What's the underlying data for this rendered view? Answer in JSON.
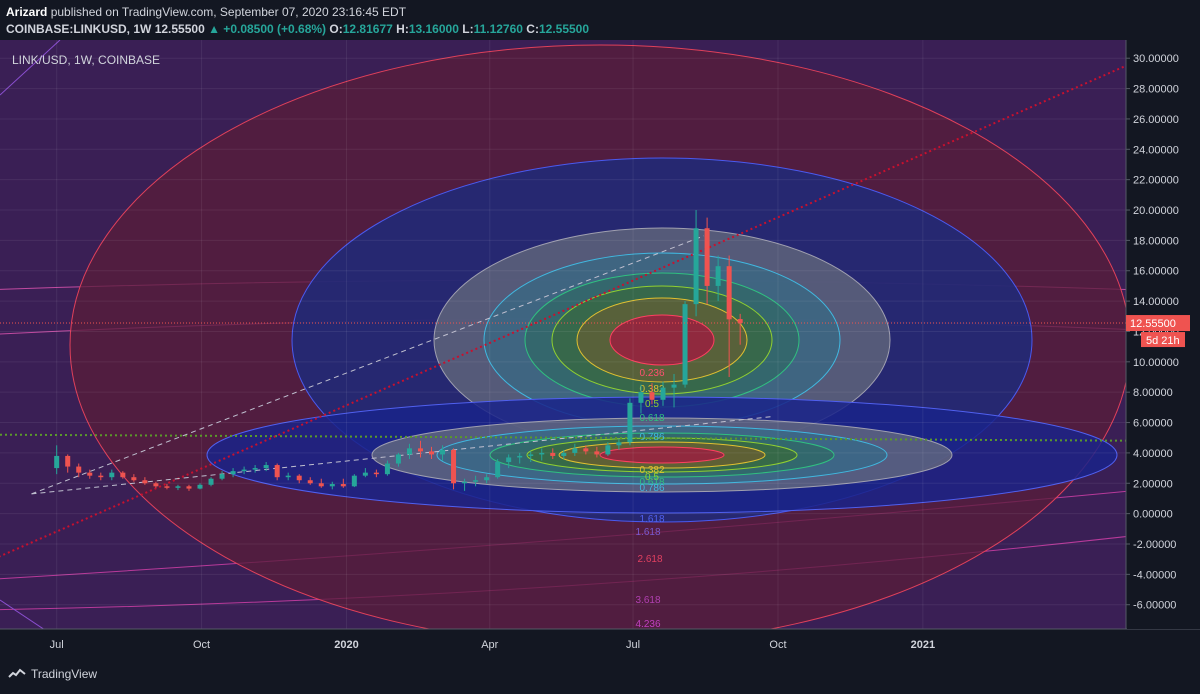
{
  "header": {
    "author": "Arizard",
    "published": "published on TradingView.com, September 07, 2020 23:16:45 EDT",
    "symbol": "COINBASE:LINKUSD, 1W",
    "last": "12.55500",
    "change": "▲ +0.08500 (+0.68%)",
    "open_label": "O:",
    "open": "12.81677",
    "high_label": "H:",
    "high": "13.16000",
    "low_label": "L:",
    "low": "11.12760",
    "close_label": "C:",
    "close": "12.55500"
  },
  "footer": {
    "brand": "TradingView"
  },
  "colors": {
    "background": "#131722",
    "up": "#26a69a",
    "down": "#ef5350",
    "price_badge": "#ef5350",
    "fib_green": "#5a9a2a",
    "trend_red": "#c8102e"
  },
  "chart_data": {
    "type": "candlestick",
    "title": "LINK/USD, 1W, COINBASE",
    "ylim": [
      -7.6,
      31.2
    ],
    "xlim": [
      "2019-05-26",
      "2021-05-10"
    ],
    "y_ticks": [
      "30.00000",
      "28.00000",
      "26.00000",
      "24.00000",
      "22.00000",
      "20.00000",
      "18.00000",
      "16.00000",
      "14.00000",
      "12.00000",
      "10.00000",
      "8.00000",
      "6.00000",
      "4.00000",
      "2.00000",
      "0.00000",
      "-2.00000",
      "-4.00000",
      "-6.00000"
    ],
    "x_ticks": [
      {
        "label": "Jul",
        "date": "2019-07-01"
      },
      {
        "label": "Oct",
        "date": "2019-10-01"
      },
      {
        "label": "2020",
        "date": "2020-01-01"
      },
      {
        "label": "Apr",
        "date": "2020-04-01"
      },
      {
        "label": "Jul",
        "date": "2020-07-01"
      },
      {
        "label": "Oct",
        "date": "2020-10-01"
      },
      {
        "label": "2021",
        "date": "2021-01-01"
      }
    ],
    "last_price": {
      "value": 12.555,
      "label": "12.55500",
      "countdown": "5d 21h"
    },
    "horizontal_dotted_level": 5.2,
    "fib_upper_labels": [
      "0.236",
      "0.382",
      "0.5",
      "0.618",
      "0.786"
    ],
    "fib_lower_labels": [
      "0.382",
      "0.5",
      "0.618",
      "0.786",
      "1.618",
      "1.618",
      "2.618",
      "3.618",
      "4.236"
    ],
    "candles": [
      {
        "d": "2019-07-01",
        "o": 3.0,
        "h": 4.5,
        "l": 2.6,
        "c": 3.8
      },
      {
        "d": "2019-07-08",
        "o": 3.8,
        "h": 3.9,
        "l": 2.7,
        "c": 3.1
      },
      {
        "d": "2019-07-15",
        "o": 3.1,
        "h": 3.3,
        "l": 2.4,
        "c": 2.7
      },
      {
        "d": "2019-07-22",
        "o": 2.7,
        "h": 2.9,
        "l": 2.3,
        "c": 2.5
      },
      {
        "d": "2019-07-29",
        "o": 2.5,
        "h": 2.7,
        "l": 2.2,
        "c": 2.4
      },
      {
        "d": "2019-08-05",
        "o": 2.4,
        "h": 2.9,
        "l": 2.2,
        "c": 2.7
      },
      {
        "d": "2019-08-12",
        "o": 2.7,
        "h": 2.8,
        "l": 2.3,
        "c": 2.4
      },
      {
        "d": "2019-08-19",
        "o": 2.4,
        "h": 2.6,
        "l": 2.1,
        "c": 2.2
      },
      {
        "d": "2019-08-26",
        "o": 2.2,
        "h": 2.4,
        "l": 1.9,
        "c": 2.0
      },
      {
        "d": "2019-09-02",
        "o": 2.0,
        "h": 2.1,
        "l": 1.7,
        "c": 1.8
      },
      {
        "d": "2019-09-09",
        "o": 1.8,
        "h": 1.95,
        "l": 1.6,
        "c": 1.7
      },
      {
        "d": "2019-09-16",
        "o": 1.7,
        "h": 1.9,
        "l": 1.55,
        "c": 1.8
      },
      {
        "d": "2019-09-23",
        "o": 1.8,
        "h": 1.9,
        "l": 1.5,
        "c": 1.65
      },
      {
        "d": "2019-09-30",
        "o": 1.65,
        "h": 2.0,
        "l": 1.6,
        "c": 1.9
      },
      {
        "d": "2019-10-07",
        "o": 1.9,
        "h": 2.4,
        "l": 1.8,
        "c": 2.3
      },
      {
        "d": "2019-10-14",
        "o": 2.3,
        "h": 2.8,
        "l": 2.2,
        "c": 2.6
      },
      {
        "d": "2019-10-21",
        "o": 2.6,
        "h": 3.0,
        "l": 2.4,
        "c": 2.8
      },
      {
        "d": "2019-10-28",
        "o": 2.8,
        "h": 3.1,
        "l": 2.6,
        "c": 2.9
      },
      {
        "d": "2019-11-04",
        "o": 2.9,
        "h": 3.2,
        "l": 2.7,
        "c": 3.0
      },
      {
        "d": "2019-11-11",
        "o": 3.0,
        "h": 3.4,
        "l": 2.8,
        "c": 3.2
      },
      {
        "d": "2019-11-18",
        "o": 3.2,
        "h": 3.3,
        "l": 2.2,
        "c": 2.4
      },
      {
        "d": "2019-11-25",
        "o": 2.4,
        "h": 2.7,
        "l": 2.2,
        "c": 2.5
      },
      {
        "d": "2019-12-02",
        "o": 2.5,
        "h": 2.6,
        "l": 2.0,
        "c": 2.2
      },
      {
        "d": "2019-12-09",
        "o": 2.2,
        "h": 2.4,
        "l": 1.9,
        "c": 2.0
      },
      {
        "d": "2019-12-16",
        "o": 2.0,
        "h": 2.3,
        "l": 1.7,
        "c": 1.8
      },
      {
        "d": "2019-12-23",
        "o": 1.8,
        "h": 2.1,
        "l": 1.6,
        "c": 1.95
      },
      {
        "d": "2019-12-30",
        "o": 1.95,
        "h": 2.3,
        "l": 1.7,
        "c": 1.8
      },
      {
        "d": "2020-01-06",
        "o": 1.8,
        "h": 2.6,
        "l": 1.75,
        "c": 2.5
      },
      {
        "d": "2020-01-13",
        "o": 2.5,
        "h": 3.0,
        "l": 2.4,
        "c": 2.7
      },
      {
        "d": "2020-01-20",
        "o": 2.7,
        "h": 2.9,
        "l": 2.4,
        "c": 2.6
      },
      {
        "d": "2020-01-27",
        "o": 2.6,
        "h": 3.5,
        "l": 2.5,
        "c": 3.3
      },
      {
        "d": "2020-02-03",
        "o": 3.3,
        "h": 4.0,
        "l": 3.1,
        "c": 3.9
      },
      {
        "d": "2020-02-10",
        "o": 3.9,
        "h": 4.6,
        "l": 3.6,
        "c": 4.3
      },
      {
        "d": "2020-02-17",
        "o": 4.3,
        "h": 4.8,
        "l": 3.7,
        "c": 4.1
      },
      {
        "d": "2020-02-24",
        "o": 4.1,
        "h": 4.4,
        "l": 3.6,
        "c": 3.9
      },
      {
        "d": "2020-03-02",
        "o": 3.9,
        "h": 4.5,
        "l": 3.5,
        "c": 4.2
      },
      {
        "d": "2020-03-09",
        "o": 4.2,
        "h": 4.3,
        "l": 1.6,
        "c": 2.0
      },
      {
        "d": "2020-03-16",
        "o": 2.0,
        "h": 2.3,
        "l": 1.5,
        "c": 2.1
      },
      {
        "d": "2020-03-23",
        "o": 2.1,
        "h": 2.5,
        "l": 1.8,
        "c": 2.2
      },
      {
        "d": "2020-03-30",
        "o": 2.2,
        "h": 2.6,
        "l": 2.0,
        "c": 2.4
      },
      {
        "d": "2020-04-06",
        "o": 2.4,
        "h": 3.6,
        "l": 2.3,
        "c": 3.4
      },
      {
        "d": "2020-04-13",
        "o": 3.4,
        "h": 3.9,
        "l": 3.0,
        "c": 3.7
      },
      {
        "d": "2020-04-20",
        "o": 3.7,
        "h": 4.0,
        "l": 3.3,
        "c": 3.8
      },
      {
        "d": "2020-04-27",
        "o": 3.8,
        "h": 4.1,
        "l": 3.4,
        "c": 3.9
      },
      {
        "d": "2020-05-04",
        "o": 3.9,
        "h": 4.3,
        "l": 3.5,
        "c": 4.0
      },
      {
        "d": "2020-05-11",
        "o": 4.0,
        "h": 4.3,
        "l": 3.6,
        "c": 3.8
      },
      {
        "d": "2020-05-18",
        "o": 3.8,
        "h": 4.2,
        "l": 3.6,
        "c": 4.0
      },
      {
        "d": "2020-05-25",
        "o": 4.0,
        "h": 4.6,
        "l": 3.8,
        "c": 4.3
      },
      {
        "d": "2020-06-01",
        "o": 4.3,
        "h": 4.5,
        "l": 3.9,
        "c": 4.1
      },
      {
        "d": "2020-06-08",
        "o": 4.1,
        "h": 4.4,
        "l": 3.7,
        "c": 3.9
      },
      {
        "d": "2020-06-15",
        "o": 3.9,
        "h": 4.7,
        "l": 3.8,
        "c": 4.5
      },
      {
        "d": "2020-06-22",
        "o": 4.5,
        "h": 4.9,
        "l": 4.2,
        "c": 4.7
      },
      {
        "d": "2020-06-29",
        "o": 4.7,
        "h": 7.6,
        "l": 4.5,
        "c": 7.3
      },
      {
        "d": "2020-07-06",
        "o": 7.3,
        "h": 8.5,
        "l": 6.6,
        "c": 8.0
      },
      {
        "d": "2020-07-13",
        "o": 8.0,
        "h": 8.6,
        "l": 7.2,
        "c": 7.5
      },
      {
        "d": "2020-07-20",
        "o": 7.5,
        "h": 8.7,
        "l": 7.1,
        "c": 8.3
      },
      {
        "d": "2020-07-27",
        "o": 8.3,
        "h": 9.2,
        "l": 7.0,
        "c": 8.5
      },
      {
        "d": "2020-08-03",
        "o": 8.5,
        "h": 14.0,
        "l": 8.3,
        "c": 13.8
      },
      {
        "d": "2020-08-10",
        "o": 13.8,
        "h": 20.0,
        "l": 13.0,
        "c": 18.8
      },
      {
        "d": "2020-08-17",
        "o": 18.8,
        "h": 19.5,
        "l": 13.8,
        "c": 15.0
      },
      {
        "d": "2020-08-24",
        "o": 15.0,
        "h": 17.0,
        "l": 14.0,
        "c": 16.3
      },
      {
        "d": "2020-08-31",
        "o": 16.3,
        "h": 17.0,
        "l": 9.0,
        "c": 12.8
      },
      {
        "d": "2020-09-07",
        "o": 12.8167,
        "h": 13.16,
        "l": 11.1276,
        "c": 12.555
      }
    ]
  }
}
